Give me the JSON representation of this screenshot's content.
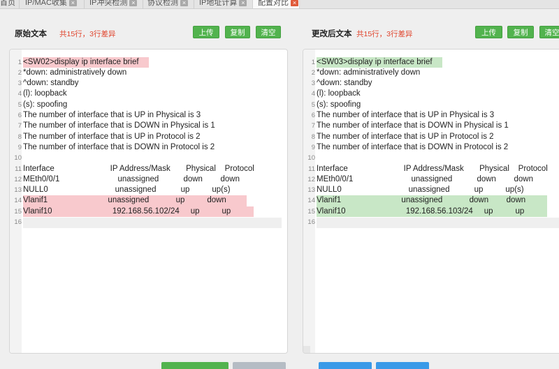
{
  "tabs": [
    {
      "label": "首页",
      "closable": false,
      "active": false
    },
    {
      "label": "IP/MAC收集",
      "closable": true,
      "active": false
    },
    {
      "label": "IP冲突检测",
      "closable": true,
      "active": false
    },
    {
      "label": "协议检测",
      "closable": true,
      "active": false
    },
    {
      "label": "IP地址计算",
      "closable": true,
      "active": false
    },
    {
      "label": "配置对比",
      "closable": true,
      "active": true
    }
  ],
  "tab_close_glyph": "×",
  "left": {
    "title": "原始文本",
    "stat": "共15行，3行差异",
    "upload": "上传",
    "copy": "复制",
    "clear": "清空",
    "lines": [
      "<SW02>display ip interface brief",
      "*down: administratively down",
      "^down: standby",
      "(l): loopback",
      "(s): spoofing",
      "The number of interface that is UP in Physical is 3",
      "The number of interface that is DOWN in Physical is 1",
      "The number of interface that is UP in Protocol is 2",
      "The number of interface that is DOWN in Protocol is 2",
      "",
      "Interface                         IP Address/Mask       Physical    Protocol",
      "MEth0/0/1                          unassigned           down        down",
      "NULL0                              unassigned           up          up(s)",
      "Vlanif1                           unassigned            up          down",
      "Vlanif10                           192.168.56.102/24     up          up",
      ""
    ],
    "diff_lines": [
      1,
      14,
      15
    ]
  },
  "right": {
    "title": "更改后文本",
    "stat": "共15行，3行差异",
    "upload": "上传",
    "copy": "复制",
    "clear": "清空",
    "lines": [
      "<SW03>display ip interface brief",
      "*down: administratively down",
      "^down: standby",
      "(l): loopback",
      "(s): spoofing",
      "The number of interface that is UP in Physical is 3",
      "The number of interface that is DOWN in Physical is 1",
      "The number of interface that is UP in Protocol is 2",
      "The number of interface that is DOWN in Protocol is 2",
      "",
      "Interface                         IP Address/Mask       Physical    Protocol",
      "MEth0/0/1                          unassigned           down        down",
      "NULL0                              unassigned           up          up(s)",
      "Vlanif1                           unassigned            down        down",
      "Vlanif10                           192.168.56.103/24     up          up",
      ""
    ],
    "diff_lines": [
      1,
      14,
      15
    ]
  },
  "colors": {
    "accent_green": "#52b34e",
    "diff_removed": "#f8c9cd",
    "diff_added": "#c8e7c6",
    "stat_red": "#e0442c",
    "bottom_green": "#52b34e",
    "bottom_gray": "#b5bcc4",
    "bottom_blue": "#3a9ae8"
  }
}
